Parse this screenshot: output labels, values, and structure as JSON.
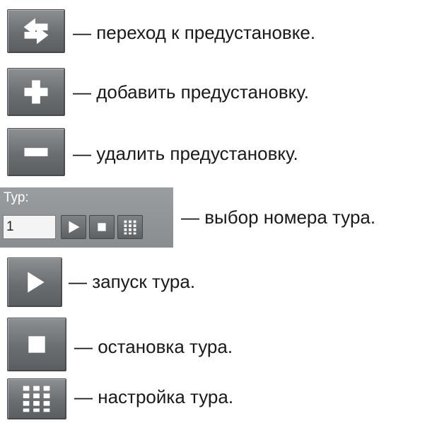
{
  "items": [
    {
      "icon": "goto-preset-icon",
      "text": "— переход к предустановке."
    },
    {
      "icon": "add-preset-icon",
      "text": "— добавить предустановку."
    },
    {
      "icon": "delete-preset-icon",
      "text": "— удалить предустановку."
    },
    {
      "icon": "tour-selector-panel",
      "text": "— выбор номера тура."
    },
    {
      "icon": "play-icon",
      "text": "— запуск тура."
    },
    {
      "icon": "stop-icon",
      "text": "— остановка тура."
    },
    {
      "icon": "grid-icon",
      "text": "— настройка тура."
    }
  ],
  "tour_panel": {
    "label": "Тур:",
    "value": "1"
  }
}
